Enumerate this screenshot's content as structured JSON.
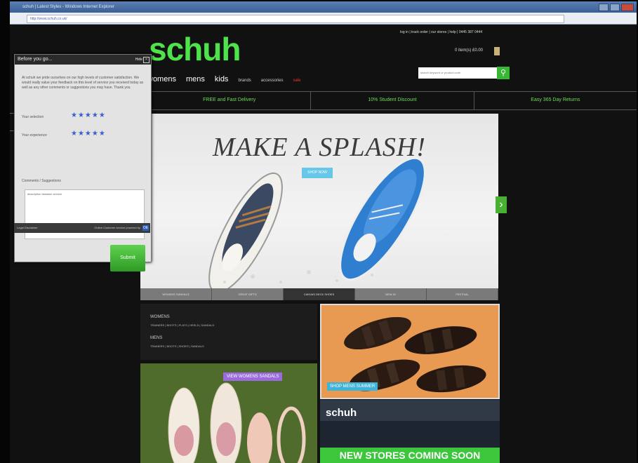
{
  "browser": {
    "window_title": "schuh | Latest Styles - Windows Internet Explorer",
    "url": "http://www.schuh.co.uk/"
  },
  "header": {
    "logo": "schuh",
    "top_links": "log in | track order | our stores | help | 0445 387 0444",
    "basket": "0 item(s) £0.00",
    "nav": {
      "womens": "womens",
      "mens": "mens",
      "kids": "kids",
      "brands": "brands",
      "accessories": "accessories",
      "sale": "sale"
    },
    "search_placeholder": "search keyword or product code",
    "search_icon": "magnifier-icon"
  },
  "promo_bar": [
    "FREE and Fast Delivery",
    "10% Student Discount",
    "Easy 365 Day Returns"
  ],
  "hero": {
    "title": "MAKE A SPLASH!",
    "cta": "SHOP NOW",
    "tabs": [
      "WOMENS SANDALS",
      "GREAT GIFTS",
      "CANVAS DECK SHOES",
      "NEW IN",
      "FESTIVAL"
    ],
    "active_tab_index": 2
  },
  "categories": {
    "womens_heading": "WOMENS",
    "womens_links": "TRAINERS | BOOTS | FLATS | HEELS | SANDALS",
    "mens_heading": "MENS",
    "mens_links": "TRAINERS | BOOTS | SHOES | SANDALS"
  },
  "tiles": {
    "mens_label": "SHOP MENS SUMMER",
    "womens_label": "VIEW WOMENS SANDALS",
    "stores_logo": "schuh",
    "stores_label": "NEW STORES COMING SOON"
  },
  "feedback": {
    "title": "Before you go...",
    "hide": "Hide",
    "intro": "At schuh we pride ourselves on our high levels of customer satisfaction. We would really value your feedback on this level of service you received today as well as any other comments or suggestions you may have. Thank you.",
    "rating1_label": "Your selection",
    "rating2_label": "Your experience",
    "stars": "★★★★★",
    "comments_label": "Comments / Suggestions",
    "comments_value": "description fantastic service",
    "submit": "Submit",
    "footer_left": "Legal Disclaimer",
    "footer_right": "Online Customer service powered by",
    "footer_logo": "OE"
  },
  "colors": {
    "brand_green": "#4ee24b",
    "promo_text": "#6fdd5a",
    "star_blue": "#3a5fcc"
  }
}
